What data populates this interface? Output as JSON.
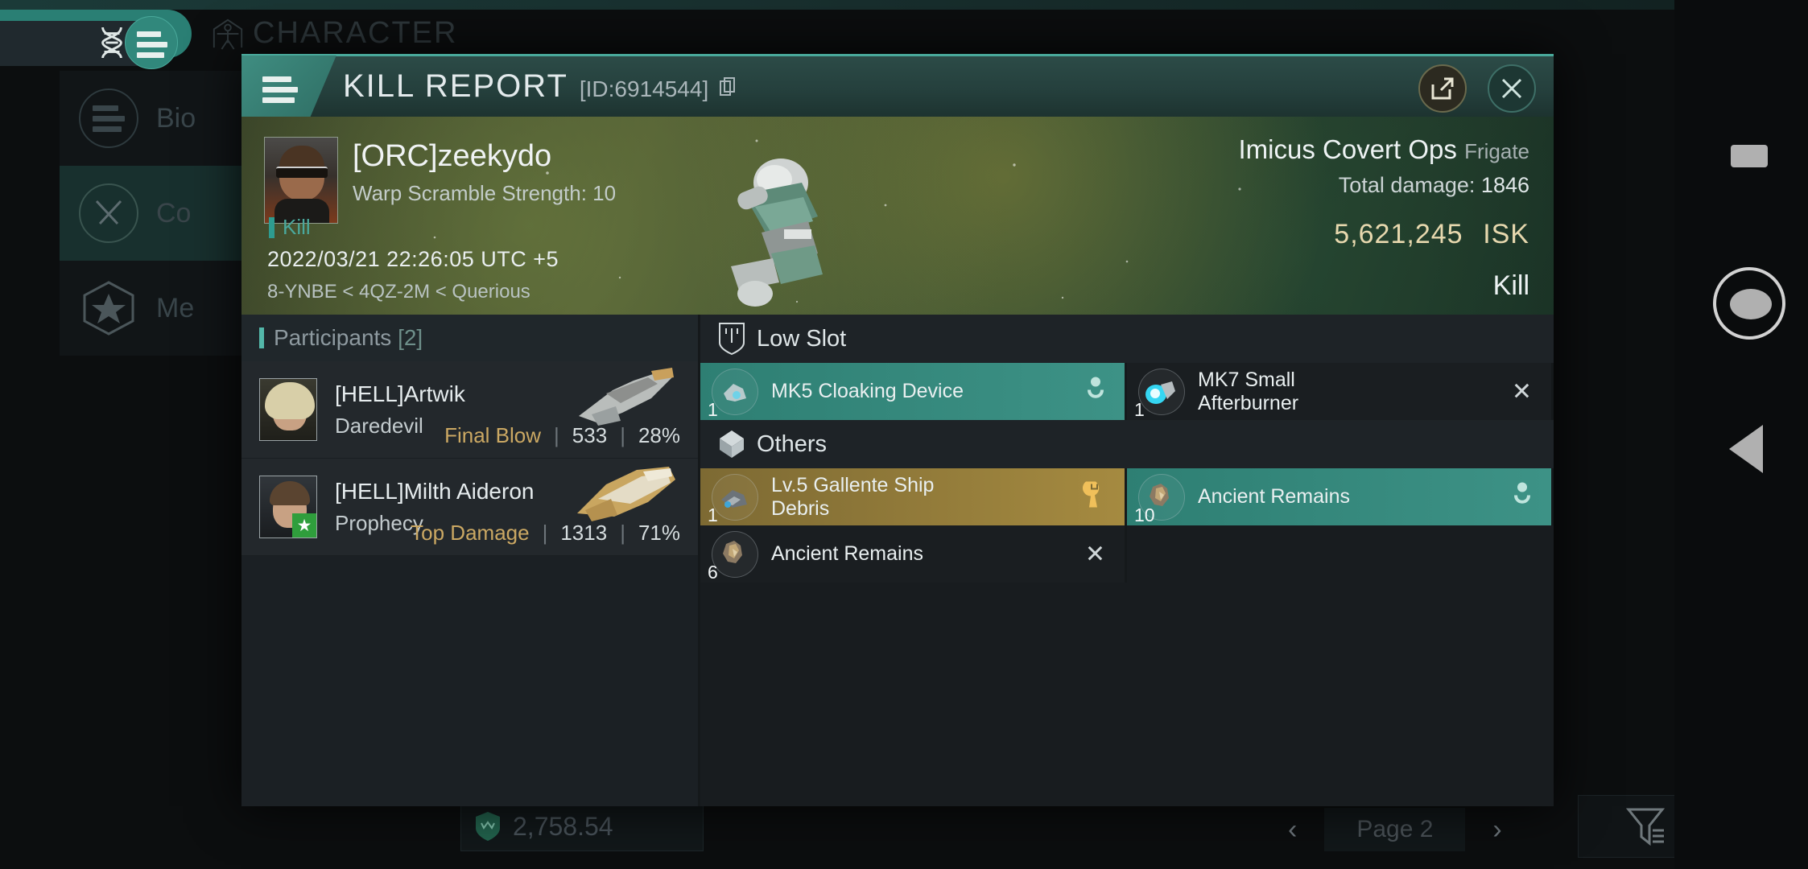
{
  "background": {
    "window_title": "CHARACTER",
    "nav_items": [
      {
        "label": "Bio",
        "icon": "list-icon",
        "selected": false
      },
      {
        "label": "Co",
        "icon": "crossed-swords-icon",
        "selected": true
      },
      {
        "label": "Me",
        "icon": "star-hexagon-icon",
        "selected": false
      }
    ],
    "wallet_amount": "2,758.54",
    "pager_label": "Page 2",
    "prev_glyph": "‹",
    "next_glyph": "›"
  },
  "modal": {
    "title": "KILL REPORT",
    "id_label": "[ID:6914544]",
    "menu_icon": "hamburger-icon",
    "share_icon": "external-link-icon",
    "close_icon": "close-icon",
    "copy_icon": "copy-icon"
  },
  "hero": {
    "victim_name": "[ORC]zeekydo",
    "victim_sub": "Warp Scramble Strength: 10",
    "kill_tag": "Kill",
    "timestamp": "2022/03/21 22:26:05 UTC +5",
    "location": "8-YNBE < 4QZ-2M < Querious",
    "ship_name": "Imicus Covert Ops",
    "ship_class": "Frigate",
    "damage_label": "Total damage:",
    "damage_value": "1846",
    "isk_value": "5,621,245",
    "isk_unit": "ISK",
    "result": "Kill",
    "isk_color": "#f0c05a"
  },
  "participants": {
    "header_label": "Participants",
    "header_count": "[2]",
    "rows": [
      {
        "name": "[HELL]Artwik",
        "ship": "Daredevil",
        "stat_label": "Final Blow",
        "damage": "533",
        "percent": "28%",
        "badge": false
      },
      {
        "name": "[HELL]Milth Aideron",
        "ship": "Prophecy",
        "stat_label": "Top Damage",
        "damage": "1313",
        "percent": "71%",
        "badge": true,
        "badge_icon": "star-badge-icon"
      }
    ]
  },
  "loot": {
    "sections": [
      {
        "title": "Low Slot",
        "icon": "low-slot-icon",
        "items": [
          {
            "qty": "1",
            "name": "MK5 Cloaking Device",
            "state": "dropped",
            "action_icon": "person-icon"
          },
          {
            "qty": "1",
            "name": "MK7 Small Afterburner",
            "state": "destroyed",
            "action_icon": "x-icon"
          }
        ]
      },
      {
        "title": "Others",
        "icon": "cube-icon",
        "items": [
          {
            "qty": "1",
            "name": "Lv.5 Gallente Ship Debris",
            "state": "salvaged",
            "action_icon": "wrench-icon"
          },
          {
            "qty": "10",
            "name": "Ancient Remains",
            "state": "dropped",
            "action_icon": "person-icon"
          },
          {
            "qty": "6",
            "name": "Ancient Remains",
            "state": "destroyed",
            "action_icon": "x-icon"
          }
        ]
      }
    ]
  },
  "android_nav": {
    "recents": "square-icon",
    "home": "circle-icon",
    "back": "triangle-back-icon"
  }
}
